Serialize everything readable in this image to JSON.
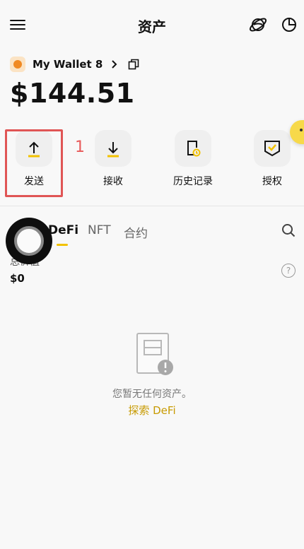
{
  "header": {
    "title": "资产"
  },
  "wallet": {
    "name": "My Wallet 8",
    "balance": "$144.51"
  },
  "actions": [
    {
      "label": "发送"
    },
    {
      "label": "接收"
    },
    {
      "label": "历史记录"
    },
    {
      "label": "授权"
    }
  ],
  "step_marker": "1",
  "tabs": [
    {
      "label": "DeFi"
    },
    {
      "label": "NFT"
    },
    {
      "label": "合约"
    }
  ],
  "summary": {
    "label": "总价值",
    "value": "$0"
  },
  "empty": {
    "message": "您暂无任何资产。",
    "cta": "探索 DeFi"
  },
  "colors": {
    "accent": "#f2c200",
    "highlight": "#e05555",
    "link": "#c79a00"
  }
}
